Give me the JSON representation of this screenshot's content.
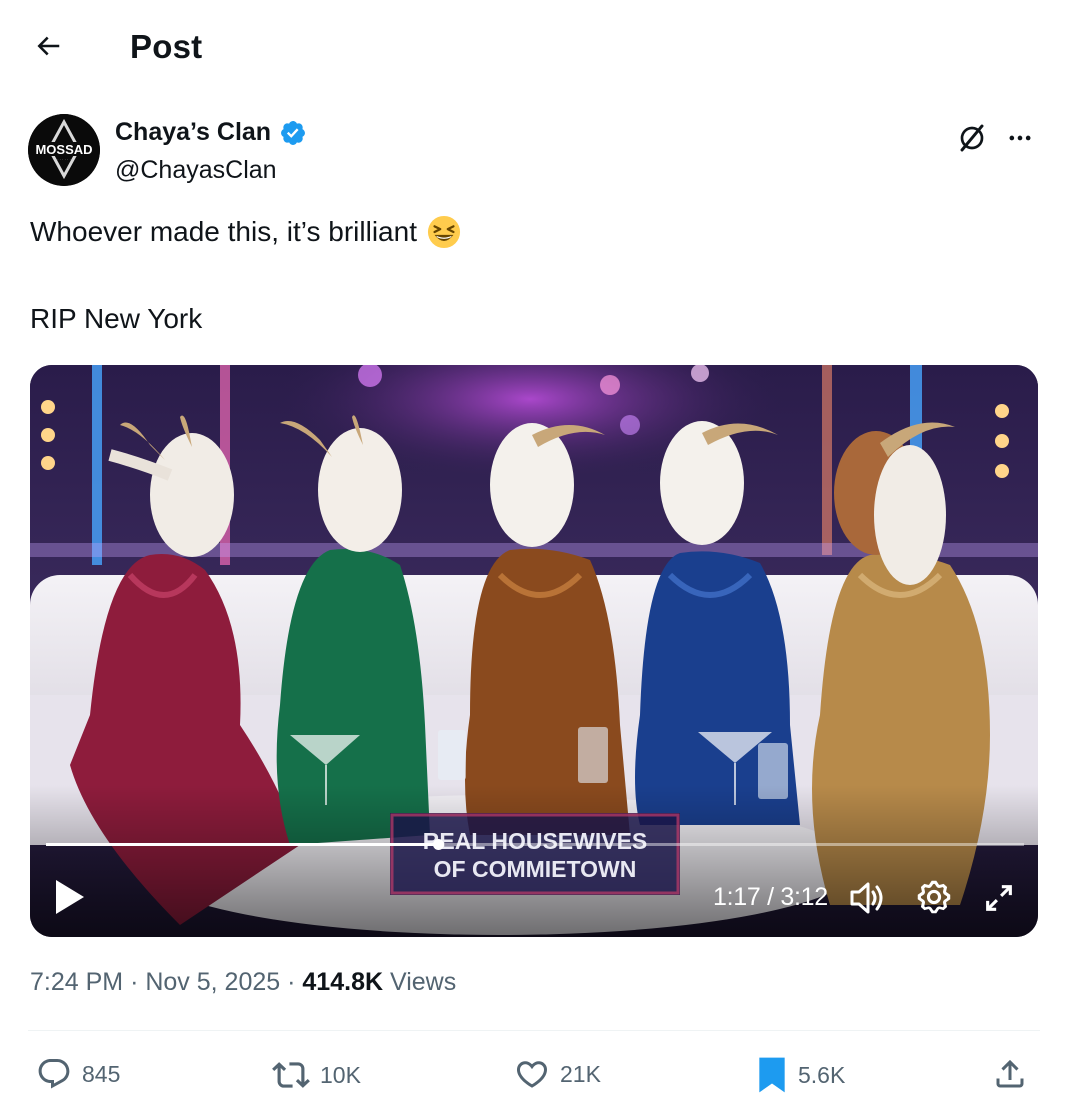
{
  "header": {
    "title": "Post"
  },
  "author": {
    "display_name": "Chaya’s Clan",
    "handle": "@ChayasClan",
    "verified": true,
    "avatar_text": "MOSSAD"
  },
  "tweet": {
    "text_line1": "Whoever made this, it’s brilliant",
    "emoji": "😆",
    "text_line2": "RIP New York"
  },
  "video": {
    "current_time": "1:17",
    "duration": "3:12",
    "time_display": "1:17 / 3:12",
    "progress": 0.401,
    "overlay_text": [
      "REAL HOUSEWIVES",
      "OF COMMIETOWN"
    ]
  },
  "meta": {
    "time": "7:24 PM",
    "date": "Nov 5, 2025",
    "views_count": "414.8K",
    "views_label": "Views",
    "separator": "·"
  },
  "actions": {
    "replies": "845",
    "reposts": "10K",
    "likes": "21K",
    "bookmarks": "5.6K"
  },
  "colors": {
    "text_primary": "#0f1419",
    "text_secondary": "#536471",
    "verified_blue": "#1d9bf0",
    "bookmark_blue": "#1d9bf0",
    "divider": "#eff3f4"
  },
  "icons": {
    "back": "arrow-left-icon",
    "verified": "verified-badge-icon",
    "grok": "grok-icon",
    "more": "more-horizontal-icon",
    "play": "play-icon",
    "volume": "volume-icon",
    "settings": "gear-icon",
    "fullscreen": "fullscreen-icon",
    "reply": "reply-icon",
    "repost": "repost-icon",
    "like": "heart-icon",
    "bookmark": "bookmark-icon",
    "share": "share-icon"
  }
}
